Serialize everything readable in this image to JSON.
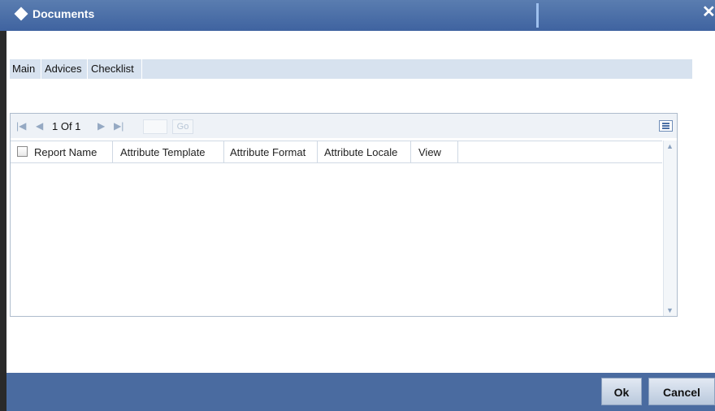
{
  "window": {
    "title": "Documents",
    "close_glyph": "✕"
  },
  "tabs": [
    {
      "label": "Main"
    },
    {
      "label": "Advices"
    },
    {
      "label": "Checklist"
    }
  ],
  "pager": {
    "first_icon": "first-page-icon",
    "prev_icon": "previous-page-icon",
    "next_icon": "next-page-icon",
    "last_icon": "last-page-icon",
    "page_text": "1 Of 1",
    "page_input_value": "",
    "go_label": "Go"
  },
  "columns": [
    {
      "label": "Report Name"
    },
    {
      "label": "Attribute Template"
    },
    {
      "label": "Attribute Format"
    },
    {
      "label": "Attribute Locale"
    },
    {
      "label": "View"
    }
  ],
  "rows": [],
  "footer": {
    "ok_label": "Ok",
    "cancel_label": "Cancel"
  },
  "colors": {
    "titlebar": "#4a6ba0",
    "tabbar": "#d7e2ef",
    "footer": "#4a6ba0"
  }
}
